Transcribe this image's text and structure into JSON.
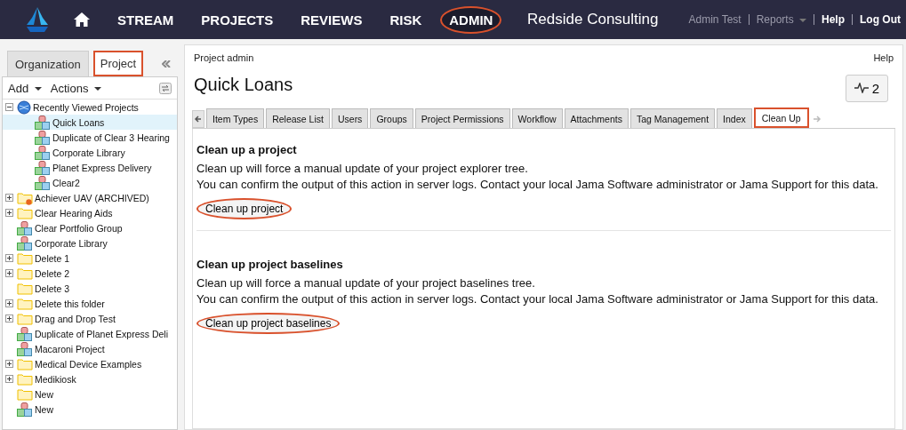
{
  "nav": {
    "items": [
      {
        "label": "STREAM",
        "selected": false,
        "highlighted": false
      },
      {
        "label": "PROJECTS",
        "selected": false,
        "highlighted": false
      },
      {
        "label": "REVIEWS",
        "selected": false,
        "highlighted": false
      },
      {
        "label": "RISK",
        "selected": false,
        "highlighted": false
      },
      {
        "label": "ADMIN",
        "selected": true,
        "highlighted": true
      }
    ],
    "org": "Redside Consulting",
    "user": "Admin Test",
    "reports": "Reports",
    "help": "Help",
    "logout": "Log Out"
  },
  "sidebar": {
    "tabs": [
      {
        "label": "Organization",
        "selected": false,
        "highlighted": false
      },
      {
        "label": "Project",
        "selected": true,
        "highlighted": true
      }
    ],
    "toolbar": [
      "Add",
      "Actions"
    ],
    "tree": [
      {
        "label": "Recently Viewed Projects",
        "kind": "globe",
        "expanded": true,
        "selected": false,
        "children": [
          {
            "label": "Quick Loans",
            "kind": "project",
            "selected": true
          },
          {
            "label": "Duplicate of Clear 3 Hearing",
            "kind": "project",
            "selected": false
          },
          {
            "label": "Corporate Library",
            "kind": "project",
            "selected": false
          },
          {
            "label": "Planet Express Delivery",
            "kind": "project",
            "selected": false
          },
          {
            "label": "Clear2",
            "kind": "project",
            "selected": false
          }
        ]
      },
      {
        "label": "Achiever UAV (ARCHIVED)",
        "kind": "archived",
        "expanded": false,
        "selected": false
      },
      {
        "label": "Clear Hearing Aids",
        "kind": "folder",
        "expanded": false,
        "selected": false
      },
      {
        "label": "Clear Portfolio Group",
        "kind": "project",
        "selected": false
      },
      {
        "label": "Corporate Library",
        "kind": "project",
        "selected": false
      },
      {
        "label": "Delete 1",
        "kind": "folder",
        "expanded": false,
        "selected": false
      },
      {
        "label": "Delete 2",
        "kind": "folder",
        "expanded": false,
        "selected": false
      },
      {
        "label": "Delete 3",
        "kind": "folder",
        "selected": false
      },
      {
        "label": "Delete this folder",
        "kind": "folder",
        "expanded": false,
        "selected": false
      },
      {
        "label": "Drag and Drop Test",
        "kind": "folder",
        "expanded": false,
        "selected": false
      },
      {
        "label": "Duplicate of Planet Express Deli",
        "kind": "project",
        "selected": false
      },
      {
        "label": "Macaroni Project",
        "kind": "project",
        "selected": false
      },
      {
        "label": "Medical Device Examples",
        "kind": "folder",
        "expanded": false,
        "selected": false
      },
      {
        "label": "Medikiosk",
        "kind": "folder",
        "expanded": false,
        "selected": false
      },
      {
        "label": "New",
        "kind": "folder",
        "selected": false
      },
      {
        "label": "New",
        "kind": "project",
        "selected": false
      }
    ]
  },
  "main": {
    "breadcrumb": "Project admin",
    "help": "Help",
    "title": "Quick Loans",
    "activity_count": "2",
    "tabs": [
      {
        "label": "Item Types",
        "selected": false,
        "highlighted": false
      },
      {
        "label": "Release List",
        "selected": false,
        "highlighted": false
      },
      {
        "label": "Users",
        "selected": false,
        "highlighted": false
      },
      {
        "label": "Groups",
        "selected": false,
        "highlighted": false
      },
      {
        "label": "Project Permissions",
        "selected": false,
        "highlighted": false
      },
      {
        "label": "Workflow",
        "selected": false,
        "highlighted": false
      },
      {
        "label": "Attachments",
        "selected": false,
        "highlighted": false
      },
      {
        "label": "Tag Management",
        "selected": false,
        "highlighted": false
      },
      {
        "label": "Index",
        "selected": false,
        "highlighted": false
      },
      {
        "label": "Clean Up",
        "selected": true,
        "highlighted": true
      }
    ],
    "sections": [
      {
        "heading": "Clean up a project",
        "lines": [
          "Clean up will force a manual update of your project explorer tree.",
          "You can confirm the output of this action in server logs. Contact your local Jama Software administrator or Jama Support for this data."
        ],
        "button": {
          "label": "Clean up project",
          "highlighted": true
        }
      },
      {
        "heading": "Clean up project baselines",
        "lines": [
          "Clean up will force a manual update of your project baselines tree.",
          "You can confirm the output of this action in server logs. Contact your local Jama Software administrator or Jama Support for this data."
        ],
        "button": {
          "label": "Clean up project baselines",
          "highlighted": true
        }
      }
    ]
  }
}
